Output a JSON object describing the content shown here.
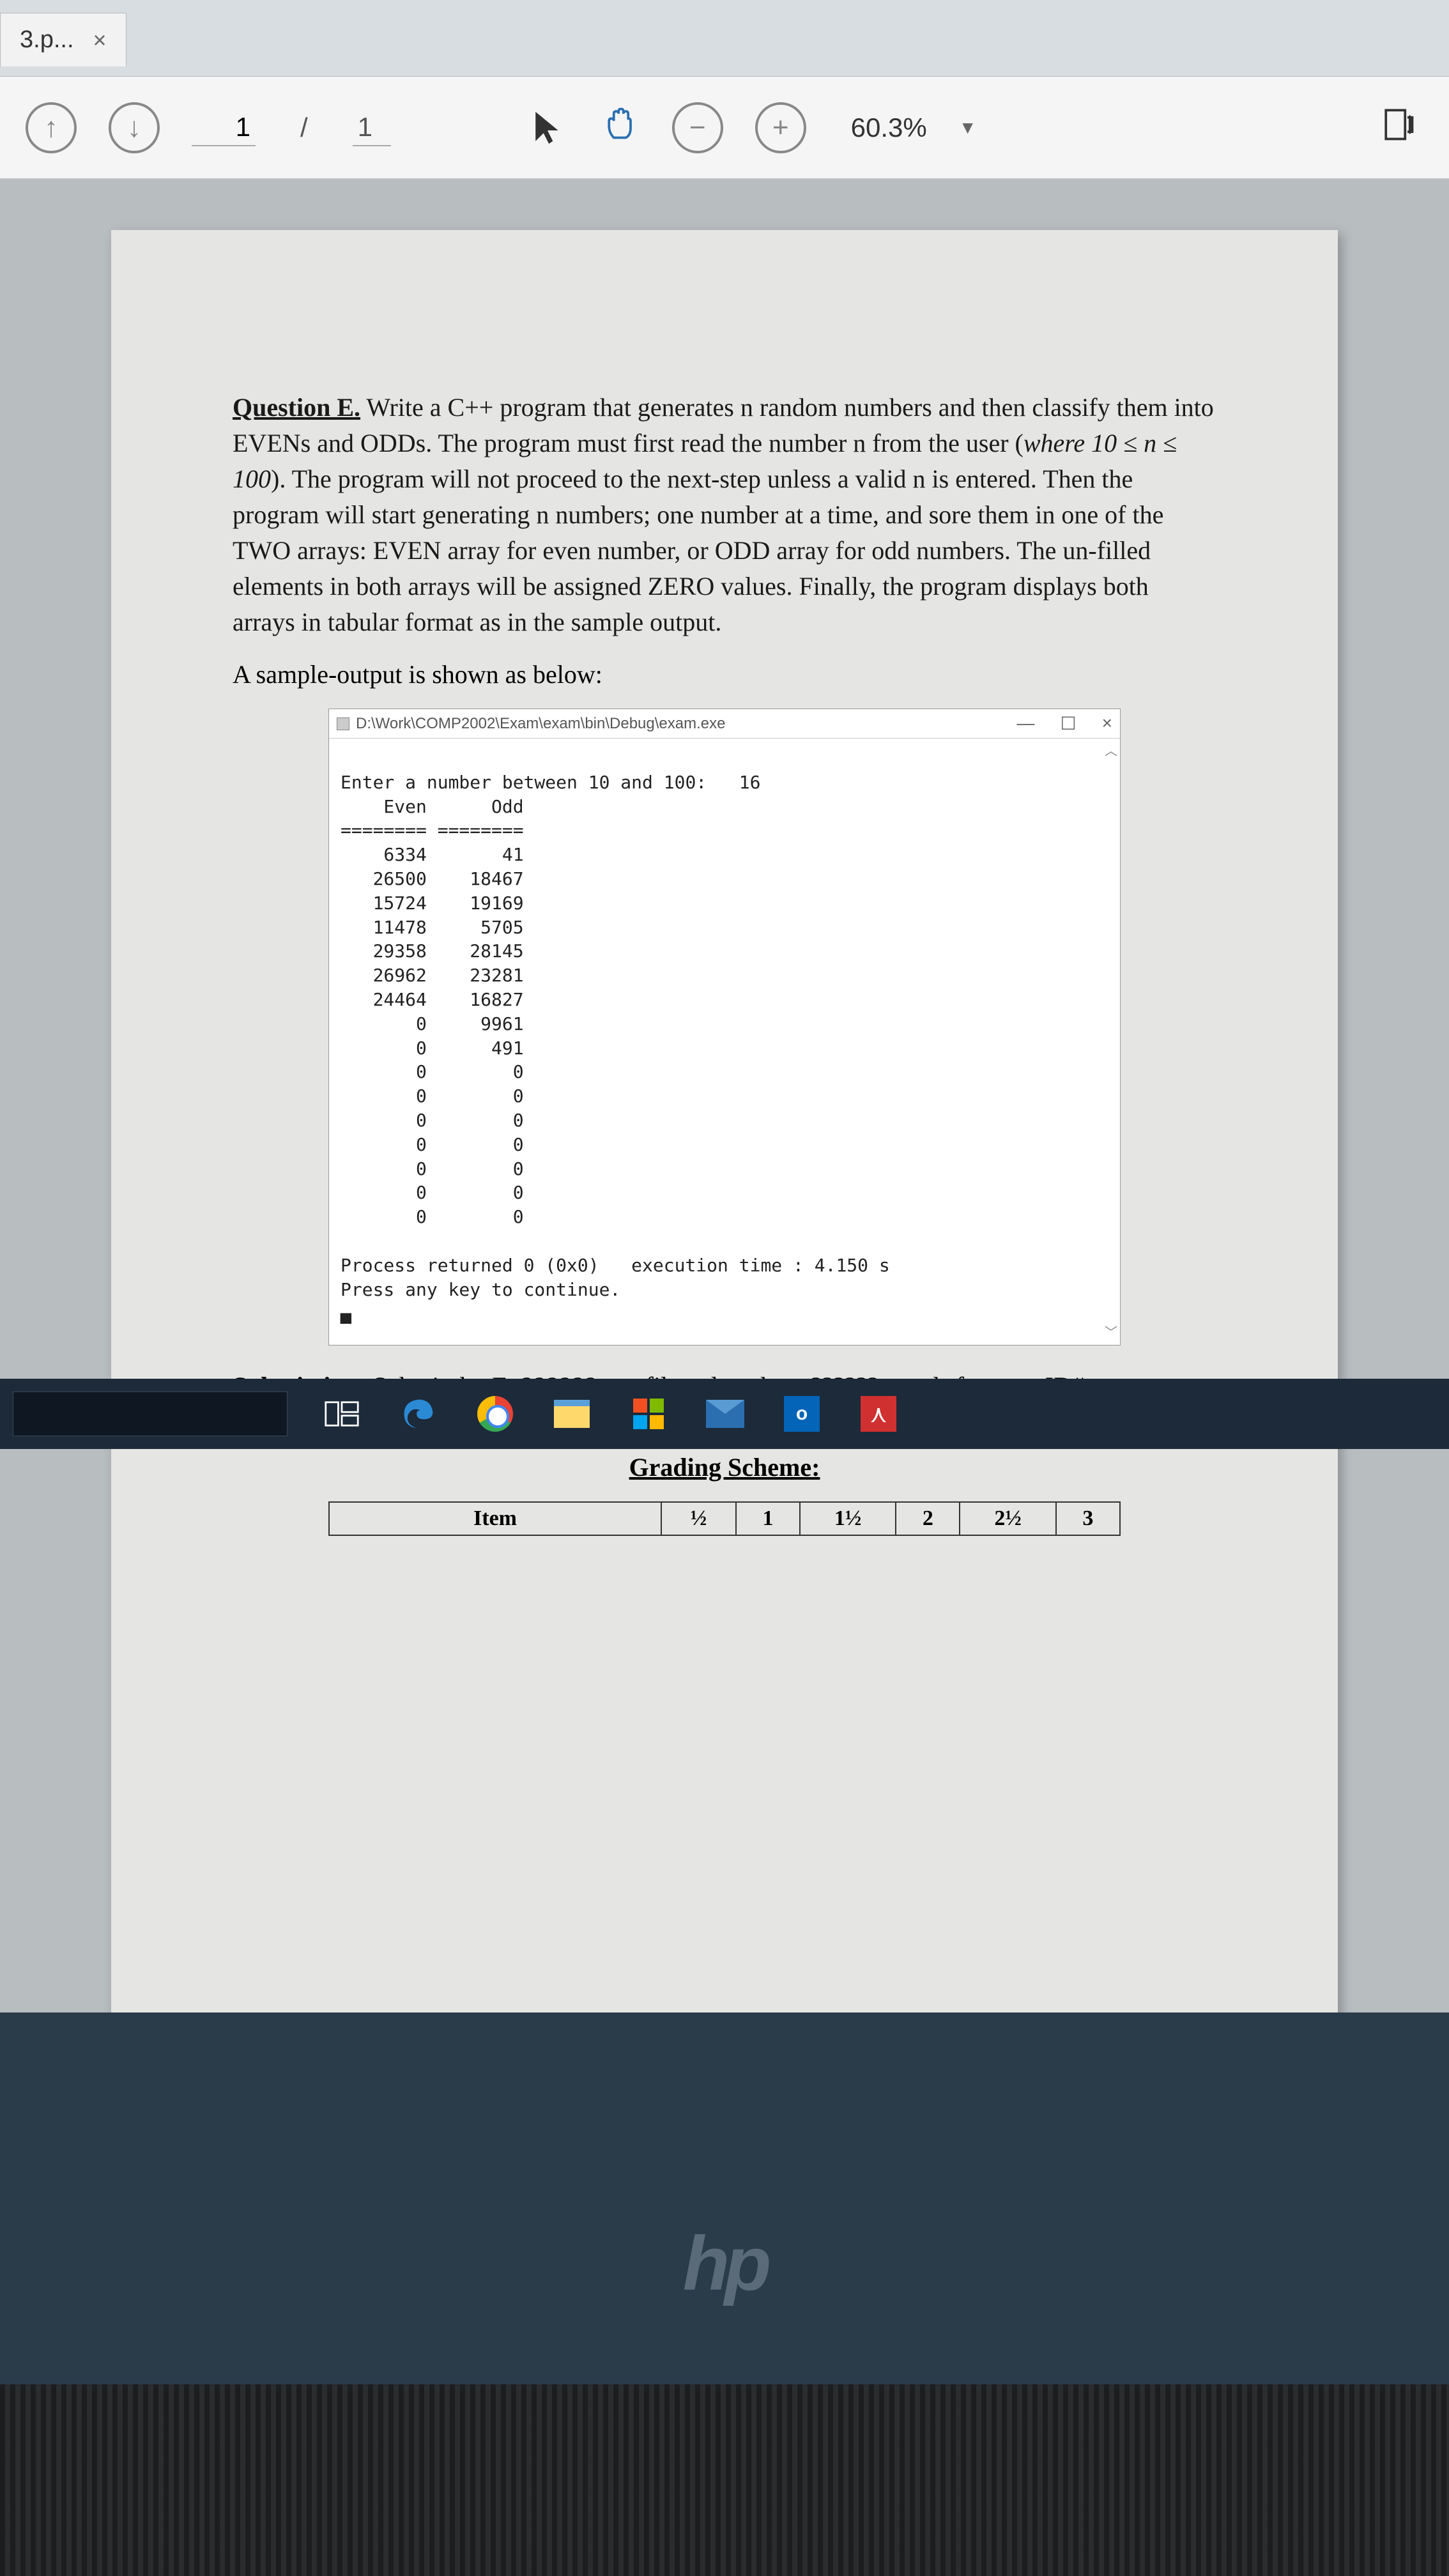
{
  "tab": {
    "title": "3.p...",
    "close": "×"
  },
  "toolbar": {
    "page_current": "1",
    "page_sep": "/",
    "page_total": "1",
    "zoom_minus": "−",
    "zoom_plus": "+",
    "zoom_pct": "60.3%",
    "dropdown": "▼"
  },
  "doc": {
    "q_label": "Question E.",
    "q_body": "  Write a C++ program that generates n random numbers and then classify them into EVENs and ODDs. The program must first read the number n from the user (",
    "q_range": "where 10 ≤ n ≤ 100",
    "q_body2": "). The program will not proceed to the next-step unless a valid n is entered. Then the program will start generating n numbers; one number at a time, and sore them in one of the TWO arrays: EVEN array for even number, or ODD array for odd numbers. The un-filled elements in both arrays will be assigned ZERO values. Finally, the program displays both arrays in tabular format as in the sample output.",
    "sample_label": "A sample-output is shown as below:",
    "console": {
      "title": "D:\\Work\\COMP2002\\Exam\\exam\\bin\\Debug\\exam.exe",
      "min": "—",
      "max": "☐",
      "close": "×",
      "prompt": "Enter a number between 10 and 100:   16",
      "header": "    Even      Odd",
      "sep": "======== ========",
      "rows": [
        "    6334       41",
        "   26500    18467",
        "   15724    19169",
        "   11478     5705",
        "   29358    28145",
        "   26962    23281",
        "   24464    16827",
        "       0     9961",
        "       0      491",
        "       0        0",
        "       0        0",
        "       0        0",
        "       0        0",
        "       0        0",
        "       0        0",
        "       0        0"
      ],
      "footer1": "Process returned 0 (0x0)   execution time : 4.150 s",
      "footer2": "Press any key to continue.",
      "cursor": "▄"
    },
    "submission_label": "Submission:",
    "submission_text": " Submit the ",
    "submission_file": "E_??????.cpp",
    "submission_text2": " file only, where ?????? stands for your ID#.",
    "grading_title": "Grading Scheme:",
    "grading_headers": [
      "Item",
      "½",
      "1",
      "1½",
      "2",
      "2½",
      "3"
    ]
  },
  "hp": "hp"
}
